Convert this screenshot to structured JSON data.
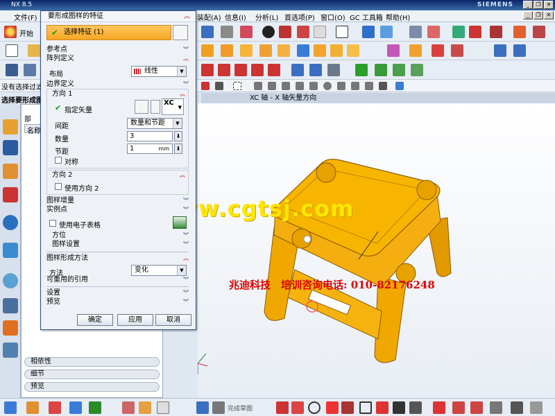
{
  "app": {
    "title": "NX 8.5",
    "brand": "SIEMENS"
  },
  "menu": {
    "file": "文件(F)",
    "assembly": "装配(A)",
    "info": "信息(I)",
    "analysis": "分析(L)",
    "preferences": "首选项(P)",
    "window": "窗口(O)",
    "gc_toolbox": "GC 工具箱",
    "help": "帮助(H)"
  },
  "toolbar": {
    "start": "开始",
    "selection_filter": "没有选择过滤",
    "prompt": "选择要形成图"
  },
  "status": {
    "message": "XC 轴 - X 轴矢量方向"
  },
  "navigator": {
    "header": "部",
    "column_name": "名称",
    "panels": [
      "相依性",
      "细节",
      "预览"
    ]
  },
  "dialog": {
    "title": "要形成图样的特征",
    "select_feature": "选择特征 (1)",
    "reference_point": "参考点",
    "array_definition": "阵列定义",
    "layout_label": "布局",
    "layout_value": "线性",
    "boundary_definition": "边界定义",
    "direction1": "方向 1",
    "specify_vector": "指定矢量",
    "vector_value": "XC",
    "spacing_label": "间距",
    "spacing_value": "数量和节距",
    "count_label": "数量",
    "count_value": "3",
    "pitch_label": "节距",
    "pitch_value": "1",
    "pitch_unit": "mm",
    "symmetric": "对称",
    "direction2": "方向 2",
    "use_direction2": "使用方向 2",
    "pattern_increment": "图样增量",
    "instance_point": "实例点",
    "use_spreadsheet": "使用电子表格",
    "orientation": "方位",
    "pattern_settings": "图样设置",
    "pattern_method": "图样形成方法",
    "method_label": "方法",
    "method_value": "变化",
    "reusable_references": "可重用的引用",
    "settings": "设置",
    "preview": "预览",
    "ok": "确定",
    "apply": "应用",
    "cancel": "取消"
  },
  "bottom": {
    "finish_sketch": "完成草图"
  },
  "overlay": {
    "website": "www.cgtsj.com",
    "contact": "兆迪科技　培训咨询电话: 010-82176248"
  },
  "colors": {
    "model": "#f7b500",
    "model_shade": "#c98a00",
    "accent_orange": "#f5a623",
    "title_blue": "#0a246a"
  }
}
